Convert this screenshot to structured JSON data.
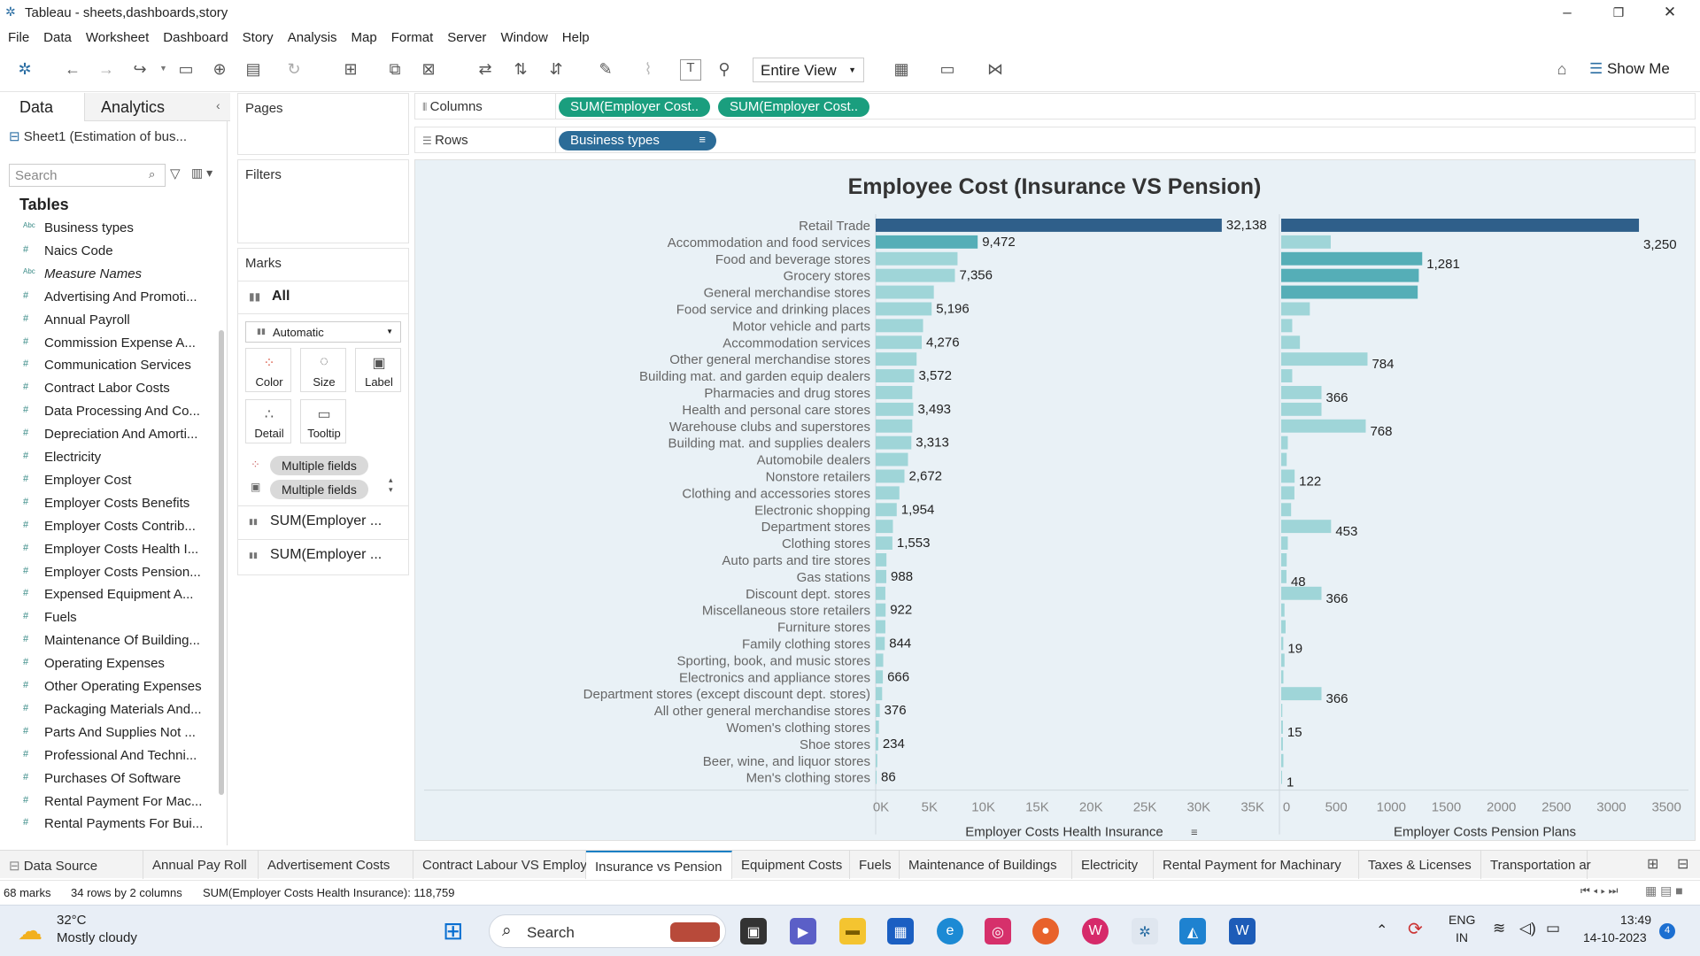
{
  "window": {
    "title": "Tableau - sheets,dashboards,story"
  },
  "menu": [
    "File",
    "Data",
    "Worksheet",
    "Dashboard",
    "Story",
    "Analysis",
    "Map",
    "Format",
    "Server",
    "Window",
    "Help"
  ],
  "toolbar": {
    "view_mode": "Entire View",
    "show_me": "Show Me"
  },
  "left_panel": {
    "tab_data": "Data",
    "tab_analytics": "Analytics",
    "datasource": "Sheet1 (Estimation of bus...",
    "search_placeholder": "Search",
    "tables_header": "Tables",
    "fields": [
      {
        "type": "Abc",
        "name": "Business types"
      },
      {
        "type": "#",
        "name": "Naics Code"
      },
      {
        "type": "Abc",
        "name": "Measure Names",
        "italic": true
      },
      {
        "type": "#",
        "name": "Advertising And Promoti..."
      },
      {
        "type": "#",
        "name": "Annual Payroll"
      },
      {
        "type": "#",
        "name": "Commission Expense A..."
      },
      {
        "type": "#",
        "name": "Communication Services"
      },
      {
        "type": "#",
        "name": "Contract Labor Costs"
      },
      {
        "type": "#",
        "name": "Data Processing And Co..."
      },
      {
        "type": "#",
        "name": "Depreciation And Amorti..."
      },
      {
        "type": "#",
        "name": "Electricity"
      },
      {
        "type": "#",
        "name": "Employer Cost"
      },
      {
        "type": "#",
        "name": "Employer Costs Benefits"
      },
      {
        "type": "#",
        "name": "Employer Costs Contrib..."
      },
      {
        "type": "#",
        "name": "Employer Costs Health I..."
      },
      {
        "type": "#",
        "name": "Employer Costs Pension..."
      },
      {
        "type": "#",
        "name": "Expensed Equipment A..."
      },
      {
        "type": "#",
        "name": "Fuels"
      },
      {
        "type": "#",
        "name": "Maintenance Of Building..."
      },
      {
        "type": "#",
        "name": "Operating Expenses"
      },
      {
        "type": "#",
        "name": "Other Operating Expenses"
      },
      {
        "type": "#",
        "name": "Packaging Materials And..."
      },
      {
        "type": "#",
        "name": "Parts And Supplies Not ..."
      },
      {
        "type": "#",
        "name": "Professional And Techni..."
      },
      {
        "type": "#",
        "name": "Purchases Of Software"
      },
      {
        "type": "#",
        "name": "Rental Payment For Mac..."
      },
      {
        "type": "#",
        "name": "Rental Payments For Bui..."
      }
    ]
  },
  "cards": {
    "pages": "Pages",
    "filters": "Filters",
    "marks": "Marks",
    "marks_all": "All",
    "mark_type": "Automatic",
    "buttons": {
      "color": "Color",
      "size": "Size",
      "label": "Label",
      "detail": "Detail",
      "tooltip": "Tooltip"
    },
    "pill_color": "Multiple fields",
    "pill_label": "Multiple fields",
    "measure1": "SUM(Employer ...",
    "measure2": "SUM(Employer ..."
  },
  "shelves": {
    "columns_label": "Columns",
    "rows_label": "Rows",
    "col_pill1": "SUM(Employer Cost..",
    "col_pill2": "SUM(Employer Cost..",
    "row_pill": "Business types"
  },
  "chart_data": {
    "type": "bar",
    "title": "Employee Cost (Insurance VS Pension)",
    "categories": [
      "Retail Trade",
      "Accommodation and food services",
      "Food and beverage stores",
      "Grocery stores",
      "General merchandise stores",
      "Food service and drinking places",
      "Motor vehicle and parts",
      "Accommodation services",
      "Other general merchandise stores",
      "Building mat. and garden equip dealers",
      "Pharmacies and drug stores",
      "Health and personal care stores",
      "Warehouse clubs and superstores",
      "Building mat. and supplies dealers",
      "Automobile dealers",
      "Nonstore retailers",
      "Clothing and accessories stores",
      "Electronic shopping",
      "Department stores",
      "Clothing stores",
      "Auto parts and tire stores",
      "Gas stations",
      "Discount dept. stores",
      "Miscellaneous store retailers",
      "Furniture stores",
      "Family clothing stores",
      "Sporting, book, and  music stores",
      "Electronics and appliance stores",
      "Department stores (except discount dept. stores)",
      "All other general merchandise stores",
      "Women's clothing stores",
      "Shoe stores",
      "Beer, wine, and liquor stores",
      "Men's clothing stores"
    ],
    "series": [
      {
        "name": "Employer Costs Health Insurance",
        "xlabel": "Employer Costs Health Insurance",
        "xlim": [
          0,
          37000
        ],
        "ticks": [
          0,
          5000,
          10000,
          15000,
          20000,
          25000,
          30000,
          35000
        ],
        "tick_labels": [
          "0K",
          "5K",
          "10K",
          "15K",
          "20K",
          "25K",
          "30K",
          "35K"
        ],
        "values": [
          32138,
          9472,
          7600,
          7356,
          5400,
          5196,
          4400,
          4276,
          3800,
          3572,
          3400,
          3493,
          3400,
          3313,
          3000,
          2672,
          2200,
          1954,
          1600,
          1553,
          1000,
          988,
          900,
          922,
          900,
          844,
          700,
          666,
          600,
          376,
          300,
          234,
          150,
          86
        ],
        "labels": [
          "32,138",
          "9,472",
          "",
          "7,356",
          "",
          "5,196",
          "",
          "4,276",
          "",
          "3,572",
          "",
          "3,493",
          "",
          "3,313",
          "",
          "2,672",
          "",
          "1,954",
          "",
          "1,553",
          "",
          "988",
          "",
          "922",
          "",
          "844",
          "",
          "666",
          "",
          "376",
          "",
          "234",
          "",
          "86"
        ]
      },
      {
        "name": "Employer Costs Pension Plans",
        "xlabel": "Employer Costs Pension Plans",
        "xlim": [
          0,
          3700
        ],
        "ticks": [
          0,
          500,
          1000,
          1500,
          2000,
          2500,
          3000,
          3500
        ],
        "tick_labels": [
          "0",
          "500",
          "1000",
          "1500",
          "2000",
          "2500",
          "3000",
          "3500"
        ],
        "values": [
          3250,
          450,
          1281,
          1250,
          1240,
          260,
          100,
          170,
          784,
          100,
          366,
          366,
          768,
          60,
          50,
          122,
          120,
          90,
          453,
          60,
          50,
          48,
          366,
          30,
          40,
          19,
          30,
          20,
          366,
          10,
          15,
          15,
          20,
          1
        ],
        "labels": [
          "3,250",
          "",
          "1,281",
          "",
          "",
          "",
          "",
          "",
          "784",
          "",
          "366",
          "",
          "768",
          "",
          "",
          "122",
          "",
          "",
          "453",
          "",
          "",
          "48",
          "366",
          "",
          "",
          "19",
          "",
          "",
          "366",
          "",
          "15",
          "",
          "",
          "1"
        ]
      }
    ],
    "colors": {
      "dark": "#2f5f8a",
      "mid": "#55aeb7",
      "light": "#9fd5d8"
    }
  },
  "bottom_tabs": [
    "Data Source",
    "Annual Pay Roll",
    "Advertisement Costs",
    "Contract Labour VS Employee",
    "Insurance vs Pension",
    "Equipment Costs",
    "Fuels",
    "Maintenance of Buildings",
    "Electricity",
    "Rental Payment for Machinary",
    "Taxes & Licenses",
    "Transportation ar"
  ],
  "active_tab": "Insurance vs Pension",
  "status": {
    "marks": "68 marks",
    "dims": "34 rows by 2 columns",
    "sum": "SUM(Employer Costs Health Insurance): 118,759"
  },
  "taskbar": {
    "temp": "32°C",
    "weather": "Mostly cloudy",
    "search": "Search",
    "lang1": "ENG",
    "lang2": "IN",
    "time": "13:49",
    "date": "14-10-2023",
    "badge": "4"
  }
}
